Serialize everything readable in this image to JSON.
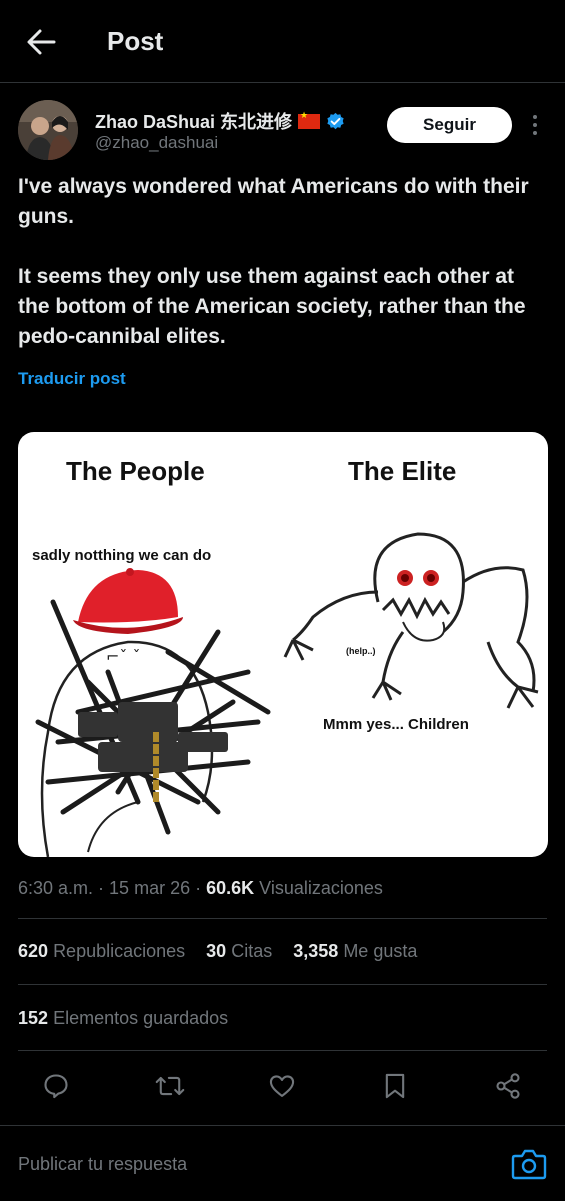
{
  "header": {
    "title": "Post"
  },
  "author": {
    "name": "Zhao DaShuai 东北进修",
    "handle": "@zhao_dashuai",
    "follow_label": "Seguir"
  },
  "tweet": {
    "paragraphs": [
      "I've always wondered what Americans do with their guns.",
      "It seems they only use them against each other at the bottom of the American society, rather than the pedo-cannibal elites."
    ],
    "translate_label": "Traducir post"
  },
  "media": {
    "left_title": "The People",
    "right_title": "The Elite",
    "left_caption": "sadly notthing we can do",
    "right_small": "(help..)",
    "right_caption": "Mmm yes... Children"
  },
  "meta": {
    "time": "6:30 a.m.",
    "date": "15 mar 26",
    "views": "60.6K",
    "views_label": "Visualizaciones"
  },
  "stats": {
    "reposts": "620",
    "reposts_label": "Republicaciones",
    "quotes": "30",
    "quotes_label": "Citas",
    "likes": "3,358",
    "likes_label": "Me gusta",
    "bookmarks": "152",
    "bookmarks_label": "Elementos guardados"
  },
  "actions": [
    "reply-icon",
    "retweet-icon",
    "like-icon",
    "bookmark-icon",
    "share-icon"
  ],
  "reply": {
    "placeholder": "Publicar tu respuesta"
  },
  "colors": {
    "accent": "#1d9bf0",
    "muted": "#71767b",
    "text": "#e7e9ea",
    "flag": "#de2910"
  }
}
